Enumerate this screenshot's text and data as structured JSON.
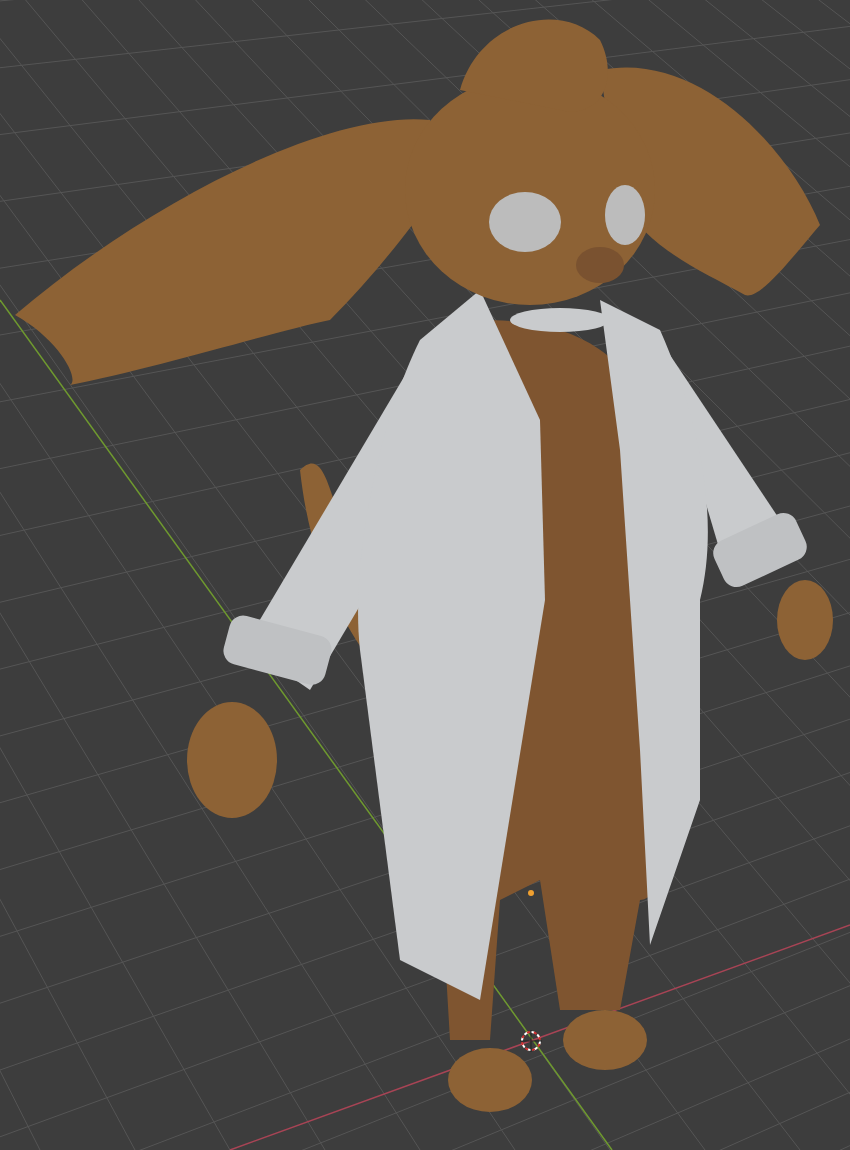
{
  "viewport": {
    "show_floor_grid": true,
    "show_axes": true,
    "show_3d_cursor": true,
    "show_origin": true
  },
  "model": {
    "visible": true
  }
}
